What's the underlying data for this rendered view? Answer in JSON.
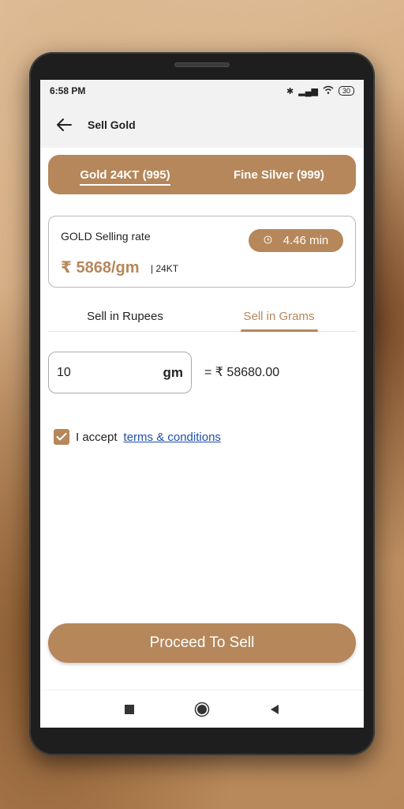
{
  "status": {
    "time": "6:58 PM",
    "battery": "30"
  },
  "appbar": {
    "title": "Sell Gold"
  },
  "metal_tabs": [
    {
      "label": "Gold 24KT (995)",
      "active": true
    },
    {
      "label": "Fine Silver (999)",
      "active": false
    }
  ],
  "rate_card": {
    "label": "GOLD Selling rate",
    "timer": "4.46 min",
    "rate": "₹ 5868/gm",
    "karat": "| 24KT"
  },
  "mode_tabs": [
    {
      "label": "Sell in Rupees",
      "active": false
    },
    {
      "label": "Sell in Grams",
      "active": true
    }
  ],
  "amount": {
    "value": "10",
    "unit": "gm",
    "result": "= ₹ 58680.00"
  },
  "terms": {
    "prefix": "I accept",
    "link": "terms & conditions",
    "checked": true
  },
  "proceed_label": "Proceed To Sell",
  "colors": {
    "accent": "#b5875a",
    "link": "#1f4fa8"
  }
}
